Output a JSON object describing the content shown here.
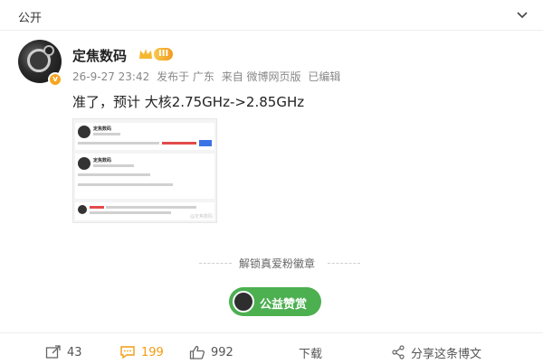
{
  "topbar": {
    "visibility_label": "公开"
  },
  "post": {
    "author": "定焦数码",
    "level_badge": "III",
    "verified_mark": "v",
    "time": "26-9-27 23:42",
    "location": "发布于 广东",
    "source": "来自 微博网页版",
    "edited": "已编辑",
    "text": "准了，预计 大核2.75GHz->2.85GHz",
    "image": {
      "card1": {
        "author": "定焦数码"
      },
      "card2": {
        "author": "定焦数码"
      },
      "watermark": "@定焦数码"
    }
  },
  "fan_badge": {
    "label": "解锁真爱粉徽章"
  },
  "reward": {
    "label": "公益赞赏"
  },
  "actions": {
    "repost_count": "43",
    "comment_count": "199",
    "like_count": "992",
    "download_label": "下载",
    "share_label": "分享这条博文"
  },
  "colors": {
    "accent": "#f39c12",
    "reward_green": "#4caf50",
    "muted": "#888888"
  }
}
